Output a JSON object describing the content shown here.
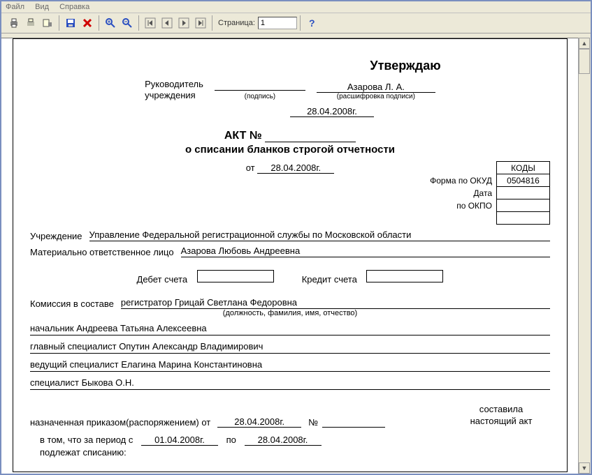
{
  "menu": {
    "file": "Файл",
    "view": "Вид",
    "help": "Справка"
  },
  "toolbar": {
    "page_label": "Страница:",
    "page_value": "1"
  },
  "approve": {
    "title": "Утверждаю",
    "leader_label1": "Руководитель",
    "leader_label2": "учреждения",
    "sign_sub": "(подпись)",
    "name_value": "Азарова Л. А.",
    "name_sub": "(расшифровка подписи)",
    "date": "28.04.2008г."
  },
  "doc": {
    "act_label": "АКТ №",
    "subtitle": "о списании бланков строгой отчетности",
    "from_label": "от",
    "from_date": "28.04.2008г."
  },
  "codes": {
    "header": "КОДЫ",
    "okud_label": "Форма по ОКУД",
    "okud_value": "0504816",
    "date_label": "Дата",
    "date_value": "",
    "okpo_label": "по ОКПО",
    "okpo_value": ""
  },
  "fields": {
    "org_label": "Учреждение",
    "org_value": "Управление Федеральной регистрационной службы по Московской области",
    "mol_label": "Материально ответственное лицо",
    "mol_value": "Азарова Любовь Андреевна",
    "debit_label": "Дебет счета",
    "credit_label": "Кредит счета"
  },
  "commission": {
    "label": "Комиссия в составе",
    "lead": "регистратор  Грицай Светлана Федоровна",
    "sub": "(должность, фамилия, имя, отчество)",
    "members": [
      "начальник  Андреева Татьяна Алексеевна",
      "главный специалист  Опутин Александр Владимирович",
      "ведущий специалист  Елагина Марина Константиновна",
      "специалист  Быкова О.Н."
    ]
  },
  "order": {
    "label": "назначенная приказом(распоряжением) от",
    "date": "28.04.2008г.",
    "num_label": "№",
    "note1": "составила",
    "note2": "настоящий акт"
  },
  "period": {
    "label": "в том, что за период с",
    "from": "01.04.2008г.",
    "to_label": "по",
    "to": "28.04.2008г.",
    "tail": "подлежат списанию:"
  }
}
